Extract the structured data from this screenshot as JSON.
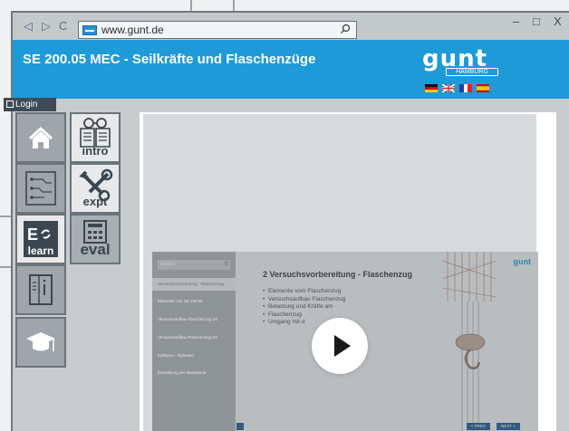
{
  "browser": {
    "url": "www.gunt.de",
    "nav": {
      "back": "◁",
      "forward": "▷",
      "reload": "C"
    },
    "search_icon": "search-icon",
    "controls": {
      "minimize": "–",
      "maximize": "□",
      "close": "X"
    }
  },
  "header": {
    "title": "SE 200.05 MEC - Seilkräfte und Flaschenzüge",
    "logo_word": "gunt",
    "logo_sub": "HAMBURG",
    "languages": [
      "de",
      "en",
      "fr",
      "es"
    ]
  },
  "login": {
    "label": "Login"
  },
  "dock": {
    "intro_label": "intro",
    "expt_label": "expt",
    "learn_label": "learn",
    "eval_label": "eval"
  },
  "slide": {
    "search_placeholder": "Search",
    "title": "2 Versuchsvorbereitung - Flaschenzug",
    "bullets": [
      "Elemente vom Flaschenzug",
      "Versuchsaufbau Flaschenzug",
      "Belastung und Kräfte am",
      "Flaschenzug",
      "Umgang mit d"
    ],
    "nav_items": [
      "Versuchsvorbereitung - Flaschenzug",
      "Elemente von SE 200.05",
      "Versuchsaufbau Flaschenzug 1/4",
      "Versuchsaufbau Flaschenzug 2/4",
      "Software - Optionen",
      "Darstellung der Messwerte"
    ],
    "brand": "gunt",
    "prev_label": "< PREV",
    "next_label": "NEXT >"
  },
  "colors": {
    "header": "#1e9ad6",
    "dock": "#9ea6ab",
    "slide_button": "#355a7f"
  }
}
